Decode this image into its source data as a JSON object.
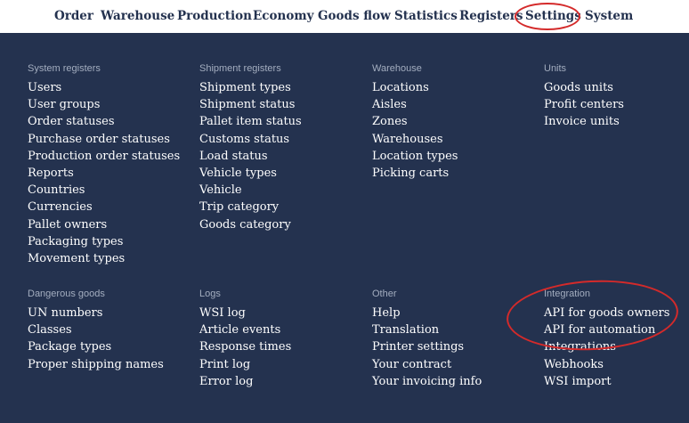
{
  "nav": {
    "items": [
      "Order",
      "Warehouse",
      "Production",
      "Economy",
      "Goods flow",
      "Statistics",
      "Registers",
      "Settings",
      "System"
    ]
  },
  "menu": {
    "groups": [
      {
        "title": "System registers",
        "items": [
          "Users",
          "User groups",
          "Order statuses",
          "Purchase order statuses",
          "Production order statuses",
          "Reports",
          "Countries",
          "Currencies",
          "Pallet owners",
          "Packaging types",
          "Movement types"
        ]
      },
      {
        "title": "Shipment registers",
        "items": [
          "Shipment types",
          "Shipment status",
          "Pallet item status",
          "Customs status",
          "Load status",
          "Vehicle types",
          "Vehicle",
          "Trip category",
          "Goods category"
        ]
      },
      {
        "title": "Warehouse",
        "items": [
          "Locations",
          "Aisles",
          "Zones",
          "Warehouses",
          "Location types",
          "Picking carts"
        ]
      },
      {
        "title": "Units",
        "items": [
          "Goods units",
          "Profit centers",
          "Invoice units"
        ]
      },
      {
        "title": "Dangerous goods",
        "items": [
          "UN numbers",
          "Classes",
          "Package types",
          "Proper shipping names"
        ]
      },
      {
        "title": "Logs",
        "items": [
          "WSI log",
          "Article events",
          "Response times",
          "Print log",
          "Error log"
        ]
      },
      {
        "title": "Other",
        "items": [
          "Help",
          "Translation",
          "Printer settings",
          "Your contract",
          "Your invoicing info"
        ]
      },
      {
        "title": "Integration",
        "items": [
          "API for goods owners",
          "API for automation",
          "Integrations",
          "Webhooks",
          "WSI import"
        ]
      }
    ]
  },
  "annotation_color": "#d42a2a",
  "accent_color": "#24324f"
}
